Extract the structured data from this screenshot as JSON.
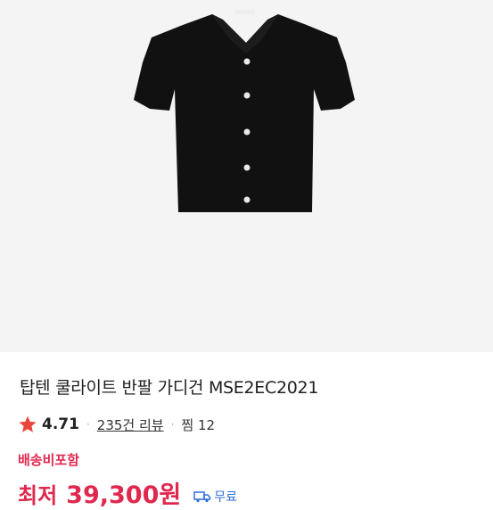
{
  "product": {
    "image_alt": "black short-sleeve knit cardigan",
    "title": "탑텐 쿨라이트 반팔 가디건 MSE2EC2021",
    "rating": "4.71",
    "separator": "·",
    "reviews": "235건 리뷰",
    "wishlist": "찜 12",
    "shipping_note": "배송비포함",
    "price_label": "최저",
    "price": "39,300원",
    "shipping_free": "무료"
  },
  "colors": {
    "accent": "#e0284f",
    "star": "#e8463a",
    "link_blue": "#2f6fd8",
    "image_bg": "#f4f4f4"
  },
  "icons": {
    "rating": "star-icon",
    "shipping": "truck-icon"
  }
}
